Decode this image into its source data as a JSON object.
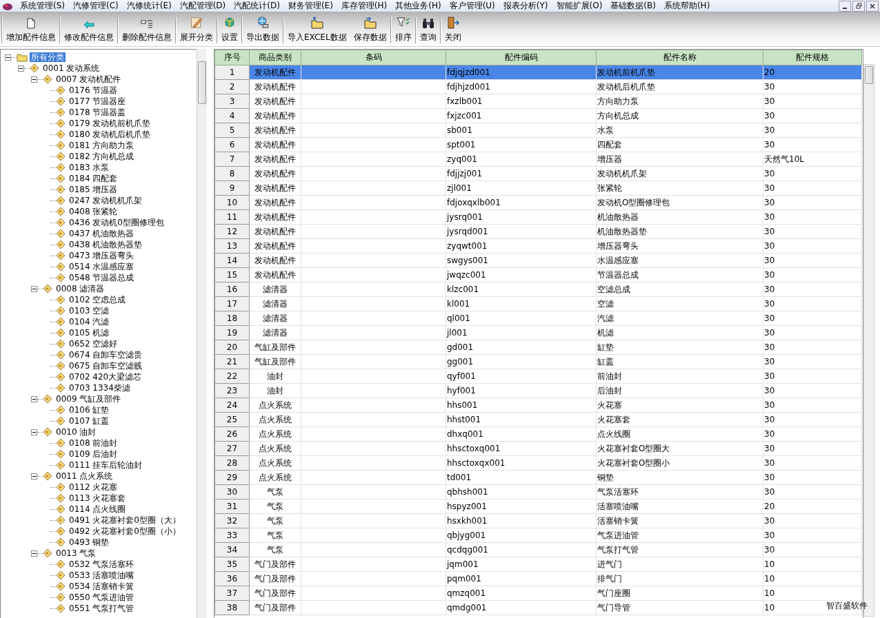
{
  "menu": [
    "系统管理(S)",
    "汽修管理(C)",
    "汽修统计(E)",
    "汽配管理(D)",
    "汽配统计(D)",
    "财务管理(E)",
    "库存管理(H)",
    "其他业务(H)",
    "客户管理(U)",
    "报表分析(Y)",
    "智能扩展(O)",
    "基础数据(B)",
    "系统帮助(H)"
  ],
  "toolbar": [
    {
      "label": "增加配件信息"
    },
    {
      "label": "修改配件信息"
    },
    {
      "label": "删除配件信息"
    },
    {
      "label": "展开分类"
    },
    {
      "label": "设置"
    },
    {
      "label": "导出数据"
    },
    {
      "label": "导入EXCEL数据"
    },
    {
      "label": "保存数据"
    },
    {
      "label": "排序"
    },
    {
      "label": "查询"
    },
    {
      "label": "关闭"
    }
  ],
  "tree": {
    "label": "所有分类",
    "selected": true,
    "expanded": true,
    "children": [
      {
        "label": "0001 发动系统",
        "selected": false,
        "expanded": true,
        "children": [
          {
            "label": "0007 发动机配件",
            "selected": false,
            "expanded": true,
            "children": [
              {
                "label": "0176 节温器",
                "selected": false
              },
              {
                "label": "0177 节温器座",
                "selected": false
              },
              {
                "label": "0178 节温器盖",
                "selected": false
              },
              {
                "label": "0179 发动机前机爪垫",
                "selected": false
              },
              {
                "label": "0180 发动机后机爪垫",
                "selected": false
              },
              {
                "label": "0181 方向助力泵",
                "selected": false
              },
              {
                "label": "0182 方向机总成",
                "selected": false
              },
              {
                "label": "0183 水泵",
                "selected": false
              },
              {
                "label": "0184 四配套",
                "selected": false
              },
              {
                "label": "0185 增压器",
                "selected": false
              },
              {
                "label": "0247 发动机机爪架",
                "selected": false
              },
              {
                "label": "0408 张紧轮",
                "selected": false
              },
              {
                "label": "0436 发动机0型圈修理包",
                "selected": false
              },
              {
                "label": "0437 机油散热器",
                "selected": false
              },
              {
                "label": "0438 机油散热器垫",
                "selected": false
              },
              {
                "label": "0473 增压器弯头",
                "selected": false
              },
              {
                "label": "0514 水温感应塞",
                "selected": false
              },
              {
                "label": "0548 节温器总成",
                "selected": false
              }
            ]
          },
          {
            "label": "0008 滤清器",
            "selected": false,
            "expanded": true,
            "children": [
              {
                "label": "0102 空虑总成",
                "selected": false
              },
              {
                "label": "0103 空滤",
                "selected": false
              },
              {
                "label": "0104 汽滤",
                "selected": false
              },
              {
                "label": "0105 机滤",
                "selected": false
              },
              {
                "label": "0652 空滤好",
                "selected": false
              },
              {
                "label": "0674 自卸车空滤贵",
                "selected": false
              },
              {
                "label": "0675 自卸车空滤贱",
                "selected": false
              },
              {
                "label": "0702 420大梁滤芯",
                "selected": false
              },
              {
                "label": "0703 1334柴滤",
                "selected": false
              }
            ]
          },
          {
            "label": "0009 气缸及部件",
            "selected": false,
            "expanded": true,
            "children": [
              {
                "label": "0106 缸垫",
                "selected": false
              },
              {
                "label": "0107 缸盖",
                "selected": false
              }
            ]
          },
          {
            "label": "0010 油封",
            "selected": false,
            "expanded": true,
            "children": [
              {
                "label": "0108 前油封",
                "selected": false
              },
              {
                "label": "0109 后油封",
                "selected": false
              },
              {
                "label": "0111 挂车后轮油封",
                "selected": false
              }
            ]
          },
          {
            "label": "0011 点火系统",
            "selected": false,
            "expanded": true,
            "children": [
              {
                "label": "0112 火花塞",
                "selected": false
              },
              {
                "label": "0113 火花塞套",
                "selected": false
              },
              {
                "label": "0114 点火线圈",
                "selected": false
              },
              {
                "label": "0491 火花塞衬套0型圈（大）",
                "selected": false
              },
              {
                "label": "0492 火花塞衬套0型圈（小）",
                "selected": false
              },
              {
                "label": "0493 铜垫",
                "selected": false
              }
            ]
          },
          {
            "label": "0013 气泵",
            "selected": false,
            "expanded": true,
            "children": [
              {
                "label": "0532 气泵活塞环",
                "selected": false
              },
              {
                "label": "0533 活塞喷油嘴",
                "selected": false
              },
              {
                "label": "0534 活塞销卡簧",
                "selected": false
              },
              {
                "label": "0550 气泵进油管",
                "selected": false
              },
              {
                "label": "0551 气泵打气管",
                "selected": false
              }
            ]
          }
        ]
      }
    ]
  },
  "table": {
    "columns": [
      "序号",
      "商品类别",
      "条码",
      "配件编码",
      "配件名称",
      "配件规格"
    ],
    "rows": [
      {
        "selected": true,
        "cells": [
          "1",
          "发动机配件",
          "",
          "fdjqjzd001",
          "发动机前机爪垫",
          "20"
        ]
      },
      {
        "selected": false,
        "cells": [
          "2",
          "发动机配件",
          "",
          "fdjhjzd001",
          "发动机后机爪垫",
          "30"
        ]
      },
      {
        "selected": false,
        "cells": [
          "3",
          "发动机配件",
          "",
          "fxzlb001",
          "方向助力泵",
          "30"
        ]
      },
      {
        "selected": false,
        "cells": [
          "4",
          "发动机配件",
          "",
          "fxjzc001",
          "方向机总成",
          "30"
        ]
      },
      {
        "selected": false,
        "cells": [
          "5",
          "发动机配件",
          "",
          "sb001",
          "水泵",
          "30"
        ]
      },
      {
        "selected": false,
        "cells": [
          "6",
          "发动机配件",
          "",
          "spt001",
          "四配套",
          "30"
        ]
      },
      {
        "selected": false,
        "cells": [
          "7",
          "发动机配件",
          "",
          "zyq001",
          "增压器",
          "天然气10L"
        ]
      },
      {
        "selected": false,
        "cells": [
          "8",
          "发动机配件",
          "",
          "fdjjzj001",
          "发动机机爪架",
          "30"
        ]
      },
      {
        "selected": false,
        "cells": [
          "9",
          "发动机配件",
          "",
          "zjl001",
          "张紧轮",
          "30"
        ]
      },
      {
        "selected": false,
        "cells": [
          "10",
          "发动机配件",
          "",
          "fdjoxqxlb001",
          "发动机O型圈修理包",
          "30"
        ]
      },
      {
        "selected": false,
        "cells": [
          "11",
          "发动机配件",
          "",
          "jysrq001",
          "机油散热器",
          "30"
        ]
      },
      {
        "selected": false,
        "cells": [
          "12",
          "发动机配件",
          "",
          "jysrqd001",
          "机油散热器垫",
          "30"
        ]
      },
      {
        "selected": false,
        "cells": [
          "13",
          "发动机配件",
          "",
          "zyqwt001",
          "增压器弯头",
          "30"
        ]
      },
      {
        "selected": false,
        "cells": [
          "14",
          "发动机配件",
          "",
          "swgys001",
          "水温感应塞",
          "30"
        ]
      },
      {
        "selected": false,
        "cells": [
          "15",
          "发动机配件",
          "",
          "jwqzc001",
          "节温器总成",
          "30"
        ]
      },
      {
        "selected": false,
        "cells": [
          "16",
          "滤清器",
          "",
          "klzc001",
          "空滤总成",
          "30"
        ]
      },
      {
        "selected": false,
        "cells": [
          "17",
          "滤清器",
          "",
          "kl001",
          "空滤",
          "30"
        ]
      },
      {
        "selected": false,
        "cells": [
          "18",
          "滤清器",
          "",
          "ql001",
          "汽滤",
          "30"
        ]
      },
      {
        "selected": false,
        "cells": [
          "19",
          "滤清器",
          "",
          "jl001",
          "机滤",
          "30"
        ]
      },
      {
        "selected": false,
        "cells": [
          "20",
          "气缸及部件",
          "",
          "gd001",
          "缸垫",
          "30"
        ]
      },
      {
        "selected": false,
        "cells": [
          "21",
          "气缸及部件",
          "",
          "gg001",
          "缸盖",
          "30"
        ]
      },
      {
        "selected": false,
        "cells": [
          "22",
          "油封",
          "",
          "qyf001",
          "前油封",
          "30"
        ]
      },
      {
        "selected": false,
        "cells": [
          "23",
          "油封",
          "",
          "hyf001",
          "后油封",
          "30"
        ]
      },
      {
        "selected": false,
        "cells": [
          "24",
          "点火系统",
          "",
          "hhs001",
          "火花塞",
          "30"
        ]
      },
      {
        "selected": false,
        "cells": [
          "25",
          "点火系统",
          "",
          "hhst001",
          "火花塞套",
          "30"
        ]
      },
      {
        "selected": false,
        "cells": [
          "26",
          "点火系统",
          "",
          "dhxq001",
          "点火线圈",
          "30"
        ]
      },
      {
        "selected": false,
        "cells": [
          "27",
          "点火系统",
          "",
          "hhsctoxq001",
          "火花塞衬套O型圈大",
          "30"
        ]
      },
      {
        "selected": false,
        "cells": [
          "28",
          "点火系统",
          "",
          "hhsctoxqx001",
          "火花塞衬套O型圈小",
          "30"
        ]
      },
      {
        "selected": false,
        "cells": [
          "29",
          "点火系统",
          "",
          "td001",
          "铜垫",
          "30"
        ]
      },
      {
        "selected": false,
        "cells": [
          "30",
          "气泵",
          "",
          "qbhsh001",
          "气泵活塞环",
          "30"
        ]
      },
      {
        "selected": false,
        "cells": [
          "31",
          "气泵",
          "",
          "hspyz001",
          "活塞喷油嘴",
          "20"
        ]
      },
      {
        "selected": false,
        "cells": [
          "32",
          "气泵",
          "",
          "hsxkh001",
          "活塞销卡簧",
          "30"
        ]
      },
      {
        "selected": false,
        "cells": [
          "33",
          "气泵",
          "",
          "qbjyg001",
          "气泵进油管",
          "30"
        ]
      },
      {
        "selected": false,
        "cells": [
          "34",
          "气泵",
          "",
          "qcdqg001",
          "气泵打气管",
          "30"
        ]
      },
      {
        "selected": false,
        "cells": [
          "35",
          "气门及部件",
          "",
          "jqm001",
          "进气门",
          "10"
        ]
      },
      {
        "selected": false,
        "cells": [
          "36",
          "气门及部件",
          "",
          "pqm001",
          "排气门",
          "10"
        ]
      },
      {
        "selected": false,
        "cells": [
          "37",
          "气门及部件",
          "",
          "qmzq001",
          "气门座圈",
          "10"
        ]
      },
      {
        "selected": false,
        "cells": [
          "38",
          "气门及部件",
          "",
          "qmdg001",
          "气门导管",
          "10"
        ]
      }
    ]
  },
  "brand_label": "智百盛软件"
}
